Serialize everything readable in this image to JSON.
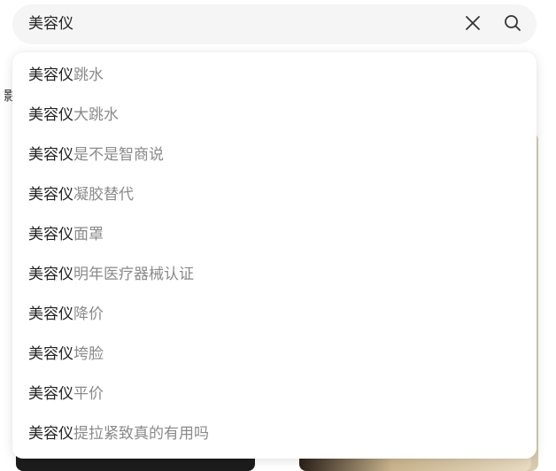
{
  "search": {
    "value": "美容仪",
    "placeholder": "",
    "clear_icon": "close-icon",
    "search_icon": "search-icon"
  },
  "background": {
    "left_fragment_text": "影"
  },
  "suggestions": {
    "keyword": "美容仪",
    "items": [
      {
        "keyword": "美容仪",
        "rest": "跳水"
      },
      {
        "keyword": "美容仪",
        "rest": "大跳水"
      },
      {
        "keyword": "美容仪",
        "rest": "是不是智商说"
      },
      {
        "keyword": "美容仪",
        "rest": "凝胶替代"
      },
      {
        "keyword": "美容仪",
        "rest": "面罩"
      },
      {
        "keyword": "美容仪",
        "rest": "明年医疗器械认证"
      },
      {
        "keyword": "美容仪",
        "rest": "降价"
      },
      {
        "keyword": "美容仪",
        "rest": "垮脸"
      },
      {
        "keyword": "美容仪",
        "rest": "平价"
      },
      {
        "keyword": "美容仪",
        "rest": "提拉紧致真的有用吗"
      }
    ]
  },
  "colors": {
    "search_bg": "#f5f5f5",
    "keyword_text": "#222222",
    "suggestion_text": "#8a8a8a",
    "icon": "#333333"
  }
}
